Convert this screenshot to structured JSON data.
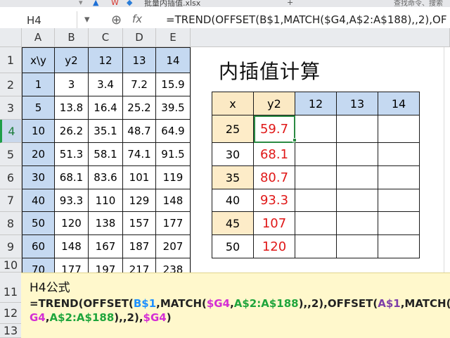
{
  "tabbar": {
    "file_tab": "批量内插值.xlsx",
    "search_text": "查找命令、搜索",
    "plus": "+"
  },
  "formula_bar": {
    "cell_ref": "H4",
    "fx_label": "fx",
    "formula": "=TREND(OFFSET(B$1,MATCH($G4,A$2:A$188),,2),OFFSET(A$1,MATCH($G4,A$2:A$188),,2),$G4)"
  },
  "columns": [
    "A",
    "B",
    "C",
    "D",
    "E"
  ],
  "rows": [
    "1",
    "2",
    "3",
    "4",
    "5",
    "6",
    "7",
    "8",
    "9",
    "10",
    "11",
    "12",
    "13"
  ],
  "left_table": {
    "header": [
      "x\\y",
      "y2",
      "12",
      "13",
      "14"
    ],
    "rows": [
      [
        "1",
        "3",
        "3.4",
        "7.2",
        "15.9"
      ],
      [
        "5",
        "13.8",
        "16.4",
        "25.2",
        "39.5"
      ],
      [
        "10",
        "26.2",
        "35.1",
        "48.7",
        "64.9"
      ],
      [
        "20",
        "51.3",
        "58.1",
        "74.1",
        "91.5"
      ],
      [
        "30",
        "68.1",
        "83.6",
        "101",
        "119"
      ],
      [
        "40",
        "93.3",
        "110",
        "129",
        "148"
      ],
      [
        "50",
        "120",
        "138",
        "157",
        "177"
      ],
      [
        "60",
        "148",
        "167",
        "187",
        "207"
      ],
      [
        "70",
        "177",
        "197",
        "217",
        "238"
      ]
    ]
  },
  "title": "内插值计算",
  "right_table": {
    "header": [
      "x",
      "y2",
      "12",
      "13",
      "14"
    ],
    "rows": [
      [
        "25",
        "59.7"
      ],
      [
        "30",
        "68.1"
      ],
      [
        "35",
        "80.7"
      ],
      [
        "40",
        "93.3"
      ],
      [
        "45",
        "107"
      ],
      [
        "50",
        "120"
      ]
    ]
  },
  "note": {
    "title": "H4公式",
    "p1": "=TREND(OFFSET(",
    "p2": "B$1",
    "p3": ",MATCH(",
    "p4": "$G4",
    "p5": ",",
    "p6": "A$2:A$188",
    "p7": "),,2),OFFSET(",
    "p8": "A$1",
    "p9": ",MATCH(",
    "p10": "$",
    "p11": "G4",
    "p12": ",",
    "p13": "A$2:A$188",
    "p14": "),,2),",
    "p15": "$G4",
    "p16": ")"
  },
  "colors": {
    "header_blue": "#c5d9f1",
    "x_highlight": "#fdecc8",
    "interp_red": "#e01818",
    "note_bg": "#fff8cc"
  }
}
